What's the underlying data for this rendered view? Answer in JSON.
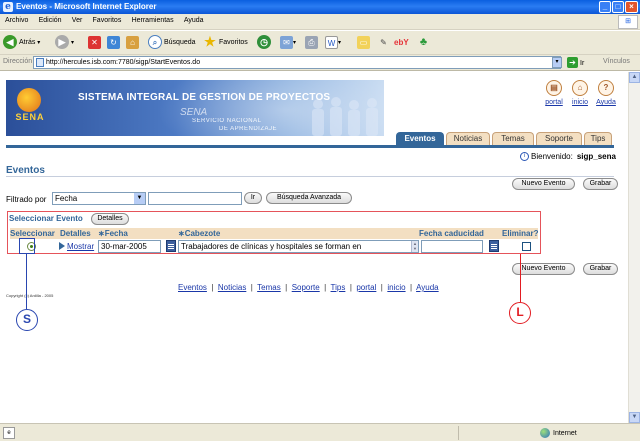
{
  "window": {
    "title": "Eventos - Microsoft Internet Explorer",
    "minimize": "_",
    "maximize": "□",
    "close": "×"
  },
  "menu": [
    "Archivo",
    "Edición",
    "Ver",
    "Favoritos",
    "Herramientas",
    "Ayuda"
  ],
  "toolbar": {
    "back": "Atrás",
    "search": "Búsqueda",
    "favorites": "Favoritos"
  },
  "address": {
    "label": "Dirección",
    "url": "http://hercules.isb.com:7780/sigp/StartEventos.do",
    "go": "Ir",
    "links": "Vínculos"
  },
  "banner": {
    "logo_text": "SENA",
    "system_title": "SISTEMA INTEGRAL DE GESTION DE PROYECTOS",
    "sena_word": "SENA",
    "servicio_line1": "SERVICIO NACIONAL",
    "servicio_line2": "DE APRENDIZAJE"
  },
  "top_links": [
    {
      "label": "portal",
      "icon": "portal-icon"
    },
    {
      "label": "inicio",
      "icon": "home-icon"
    },
    {
      "label": "Ayuda",
      "icon": "help-icon"
    }
  ],
  "tabs": [
    {
      "label": "Eventos",
      "active": true
    },
    {
      "label": "Noticias",
      "active": false
    },
    {
      "label": "Temas",
      "active": false
    },
    {
      "label": "Soporte",
      "active": false
    },
    {
      "label": "Tips",
      "active": false
    }
  ],
  "welcome": {
    "label": "Bienvenido:",
    "user": "sigp_sena"
  },
  "section_title": "Eventos",
  "buttons": {
    "nuevo_evento": "Nuevo Evento",
    "grabar": "Grabar",
    "ir": "Ir",
    "busqueda_avanzada": "Búsqueda Avanzada",
    "detalles": "Detalles"
  },
  "filter": {
    "label": "Filtrado por",
    "selected": "Fecha",
    "value": ""
  },
  "table": {
    "title": "Seleccionar Evento",
    "headers": {
      "seleccionar": "Seleccionar",
      "detalles": "Detalles",
      "fecha": "∗Fecha",
      "cabezote": "∗Cabezote",
      "fecha_caducidad": "Fecha caducidad",
      "eliminar": "Eliminar?"
    },
    "rows": [
      {
        "mostrar": "Mostrar",
        "fecha": "30-mar-2005",
        "cabezote": "Trabajadores de clínicas y hospitales se forman en",
        "fecha_caducidad": "",
        "eliminar": false,
        "selected": true
      }
    ]
  },
  "footer_links": [
    "Eventos",
    "Noticias",
    "Temas",
    "Soporte",
    "Tips",
    "portal",
    "inicio",
    "Ayuda"
  ],
  "copyright": "Copyright (c) Ardilla - 2005",
  "callouts": {
    "s": "S",
    "l": "L"
  },
  "status": {
    "zone": "Internet"
  },
  "colors": {
    "accent": "#336699",
    "tab_inactive": "#f3dfc2",
    "link": "#1a37a8",
    "callout_red": "#e21c22",
    "callout_blue": "#2946b0"
  }
}
